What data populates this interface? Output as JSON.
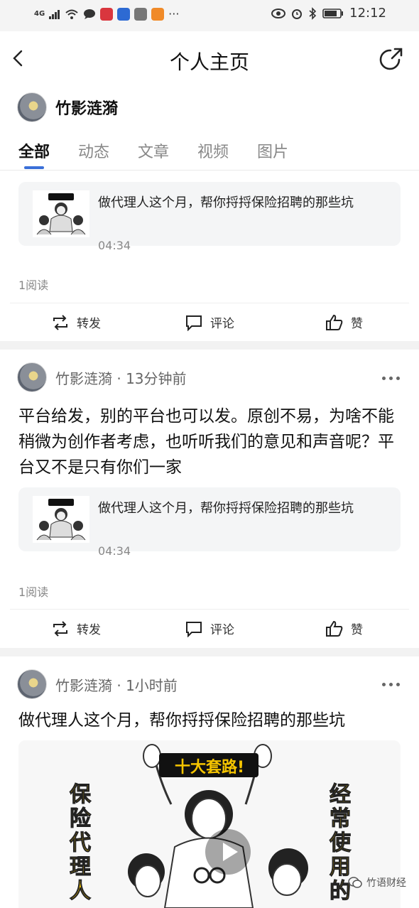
{
  "status_bar": {
    "network": "4G",
    "time": "12:12"
  },
  "nav": {
    "title": "个人主页"
  },
  "profile": {
    "name": "竹影涟漪"
  },
  "tabs": [
    {
      "label": "全部",
      "active": true
    },
    {
      "label": "动态",
      "active": false
    },
    {
      "label": "文章",
      "active": false
    },
    {
      "label": "视频",
      "active": false
    },
    {
      "label": "图片",
      "active": false
    }
  ],
  "posts": [
    {
      "card": {
        "title": "做代理人这个月，帮你捋捋保险招聘的那些坑",
        "duration": "04:34"
      },
      "reads": "1阅读"
    },
    {
      "author": "竹影涟漪",
      "time": "13分钟前",
      "text": "平台给发，别的平台也可以发。原创不易，为啥不能稍微为创作者考虑，也听听我们的意见和声音呢？平台又不是只有你们一家",
      "card": {
        "title": "做代理人这个月，帮你捋捋保险招聘的那些坑",
        "duration": "04:34"
      },
      "reads": "1阅读"
    },
    {
      "author": "竹影涟漪",
      "time": "1小时前",
      "text": "做代理人这个月，帮你捋捋保险招聘的那些坑",
      "image": {
        "banner": "十大套路!",
        "left_text": "保险代理人",
        "right_text": "经常使用的"
      }
    }
  ],
  "actions": {
    "repost": "转发",
    "comment": "评论",
    "like": "赞"
  },
  "watermark": "竹语财经",
  "colors": {
    "accent": "#3a6fd8"
  }
}
